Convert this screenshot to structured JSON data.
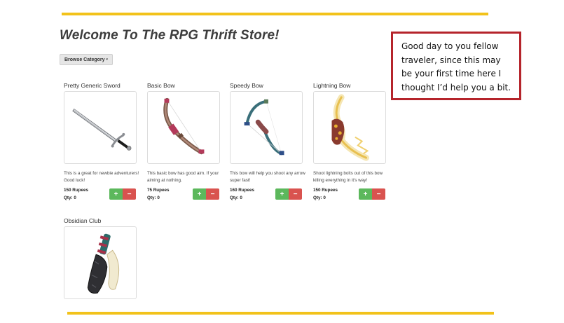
{
  "store": {
    "title": "Welcome To The RPG Thrift Store!",
    "browse_label": "Browse Category",
    "caret": "▾"
  },
  "products": [
    {
      "name": "Pretty Generic Sword",
      "description": "This is a great for newbie adventurers! Good luck!",
      "price": "150 Rupees",
      "qty_label": "Qty:",
      "qty": "0",
      "image": "sword-image"
    },
    {
      "name": "Basic Bow",
      "description": "This basic bow has good aim. If your aiming at nothing.",
      "price": "75 Rupees",
      "qty_label": "Qty:",
      "qty": "0",
      "image": "basic-bow-image"
    },
    {
      "name": "Speedy Bow",
      "description": "This bow will help you shoot any arrow super fast!",
      "price": "160 Rupees",
      "qty_label": "Qty:",
      "qty": "0",
      "image": "speedy-bow-image"
    },
    {
      "name": "Lightning Bow",
      "description": "Shoot lightning bolts out of this bow killing everything in it's way!",
      "price": "150 Rupees",
      "qty_label": "Qty:",
      "qty": "0",
      "image": "lightning-bow-image"
    },
    {
      "name": "Obsidian Club",
      "image": "obsidian-club-image"
    }
  ],
  "controls": {
    "plus": "+",
    "minus": "−"
  },
  "tooltip": {
    "text": "Good day to you fellow traveler, since this may be your first time here I thought I’d help you a bit."
  },
  "colors": {
    "accent_rule": "#f2c21a",
    "plus_button": "#5cb85c",
    "minus_button": "#d9534f",
    "tooltip_border": "#b5242b"
  }
}
